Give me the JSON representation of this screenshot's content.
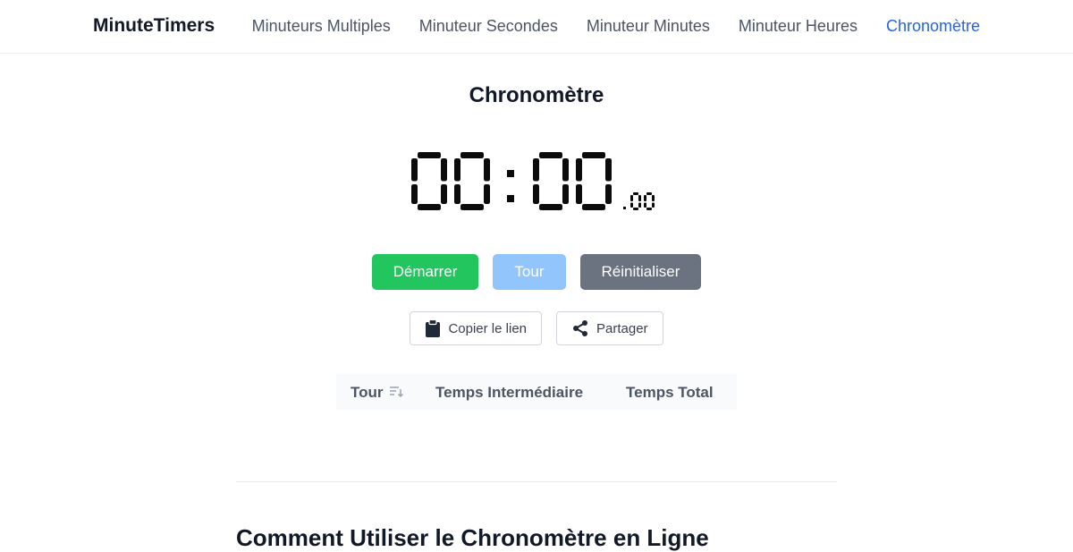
{
  "navbar": {
    "brand": "MinuteTimers",
    "links": [
      {
        "label": "Minuteurs Multiples",
        "active": false
      },
      {
        "label": "Minuteur Secondes",
        "active": false
      },
      {
        "label": "Minuteur Minutes",
        "active": false
      },
      {
        "label": "Minuteur Heures",
        "active": false
      },
      {
        "label": "Chronomètre",
        "active": true
      }
    ]
  },
  "page_title": "Chronomètre",
  "timer": {
    "minutes": "00",
    "separator": ":",
    "seconds": "00",
    "hundredths": "00"
  },
  "controls": {
    "start_label": "Démarrer",
    "lap_label": "Tour",
    "reset_label": "Réinitialiser",
    "lap_disabled": true
  },
  "share": {
    "copy_label": "Copier le lien",
    "copy_icon": "clipboard-icon",
    "share_label": "Partager",
    "share_icon": "share-icon"
  },
  "laps_table": {
    "columns": [
      "Tour",
      "Temps Intermédiaire",
      "Temps Total"
    ],
    "sort_icon": "sort-icon",
    "rows": []
  },
  "section": {
    "heading": "Comment Utiliser le Chronomètre en Ligne"
  },
  "colors": {
    "accent": "#2563eb",
    "start": "#22c55e",
    "lap": "#93c5fd",
    "reset": "#6b7280"
  }
}
